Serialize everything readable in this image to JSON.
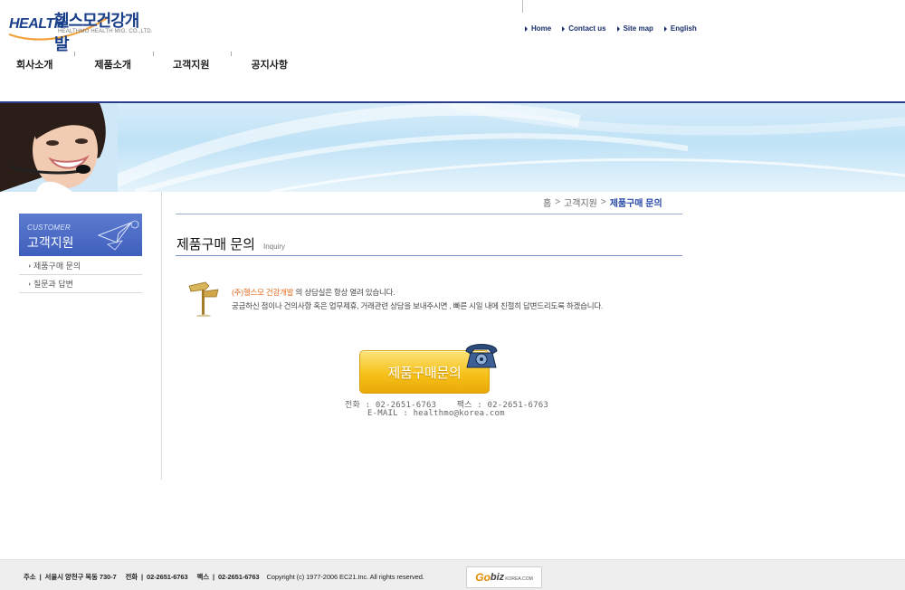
{
  "header": {
    "logo": {
      "en": "HEALTH",
      "ko": "헬스모건강개발",
      "sub": "HEALTHMO HEALTH MIG. CO.,LTD."
    },
    "util_nav": [
      "Home",
      "Contact us",
      "Site map",
      "English"
    ],
    "gnb": [
      "회사소개",
      "제품소개",
      "고객지원",
      "공지사항"
    ]
  },
  "sidebar": {
    "title_en": "CUSTOMER",
    "title_ko": "고객지원",
    "items": [
      "제품구매 문의",
      "질문과 답변"
    ]
  },
  "breadcrumb": {
    "home": "홈",
    "sep": ">",
    "section": "고객지원",
    "current": "제품구매 문의"
  },
  "main": {
    "title": "제품구매 문의",
    "title_en": "Inquiry",
    "intro_company": "(주)헬스모 건강개발",
    "intro_line1": " 의 상담실은 항상 열려 있습니다.",
    "intro_line2": "궁금하신 점이나 건의사항 혹은 업무제휴, 거래관련 상담을 보내주시면 , 빠른 시일 내에 친절히 답변드리도록 하겠습니다.",
    "inquiry_button": "제품구매문의",
    "contact_line1": "전화 : 02-2651-6763    팩스 : 02-2651-6763",
    "contact_line2": "E-MAIL : healthmo@korea.com"
  },
  "footer": {
    "info": "주소  |  서울시 양천구 목동 730-7     전화  |  02-2651-6763     팩스  |  02-2651-6763",
    "copyright": "Copyright (c) 1977-2006 EC21.Inc. All rights reserved.",
    "gobiz": {
      "g": "Go",
      "biz": "biz",
      "domain": "KOREA.COM"
    }
  },
  "colors": {
    "brand_navy": "#1a3f8a",
    "accent_orange": "#e66a1d",
    "button_yellow": "#f6c21a",
    "lnb_blue": "#4a6ac4"
  }
}
